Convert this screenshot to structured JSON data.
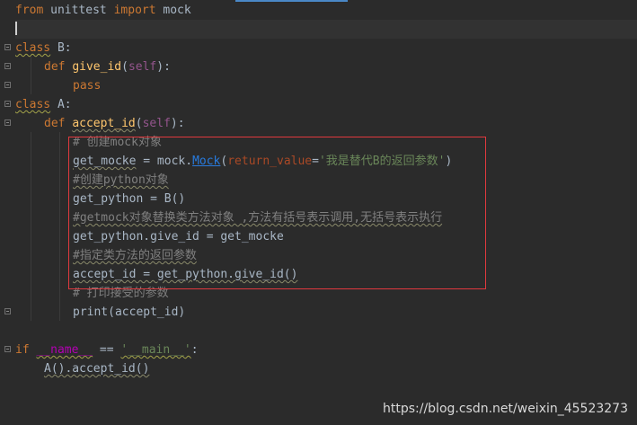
{
  "lines": {
    "l1": {
      "kw_from": "from",
      "mid": " unittest ",
      "kw_import": "import",
      "tail": " mock"
    },
    "l3": {
      "kw": "class",
      "name": " B:"
    },
    "l4": {
      "kw": "def",
      "fn": "give_id",
      "open": "(",
      "self": "self",
      "close": "):"
    },
    "l5": {
      "kw": "pass"
    },
    "l6": {
      "kw": "class",
      "name": " A:"
    },
    "l7": {
      "kw": "def",
      "fn": "accept_id",
      "open": "(",
      "self": "self",
      "close": "):"
    },
    "l8": {
      "comment": "# 创建mock对象"
    },
    "l9": {
      "var": "get_mocke",
      "eq": " = mock.",
      "cls": "Mock",
      "open": "(",
      "param": "return_value",
      "eq2": "=",
      "str": "'我是替代B的返回参数'",
      "close": ")"
    },
    "l10": {
      "comment": "#创建python对象"
    },
    "l11": {
      "text": "get_python = B()"
    },
    "l12": {
      "comment": "#getmock对象替换类方法对象 ,方法有括号表示调用,无括号表示执行"
    },
    "l13": {
      "text": "get_python.give_id = get_mocke"
    },
    "l14": {
      "comment": "#指定类方法的返回参数"
    },
    "l15": {
      "text": "accept_id = get_python.give_id()"
    },
    "l16": {
      "comment": "# 打印接受的参数"
    },
    "l17": {
      "text": "print(accept_id)"
    },
    "l19": {
      "kw": "if",
      "sp": " ",
      "name": "__name__",
      "eq": " == ",
      "str": "'__main__'",
      "colon": ":"
    },
    "l20": {
      "text": "A().accept_id()"
    }
  },
  "watermark": "https://blog.csdn.net/weixin_45523273",
  "colors": {
    "background": "#2b2b2b",
    "keyword": "#cc7832",
    "function": "#ffc66d",
    "comment": "#808080",
    "string": "#6a8759",
    "highlight_border": "#e0393e"
  }
}
